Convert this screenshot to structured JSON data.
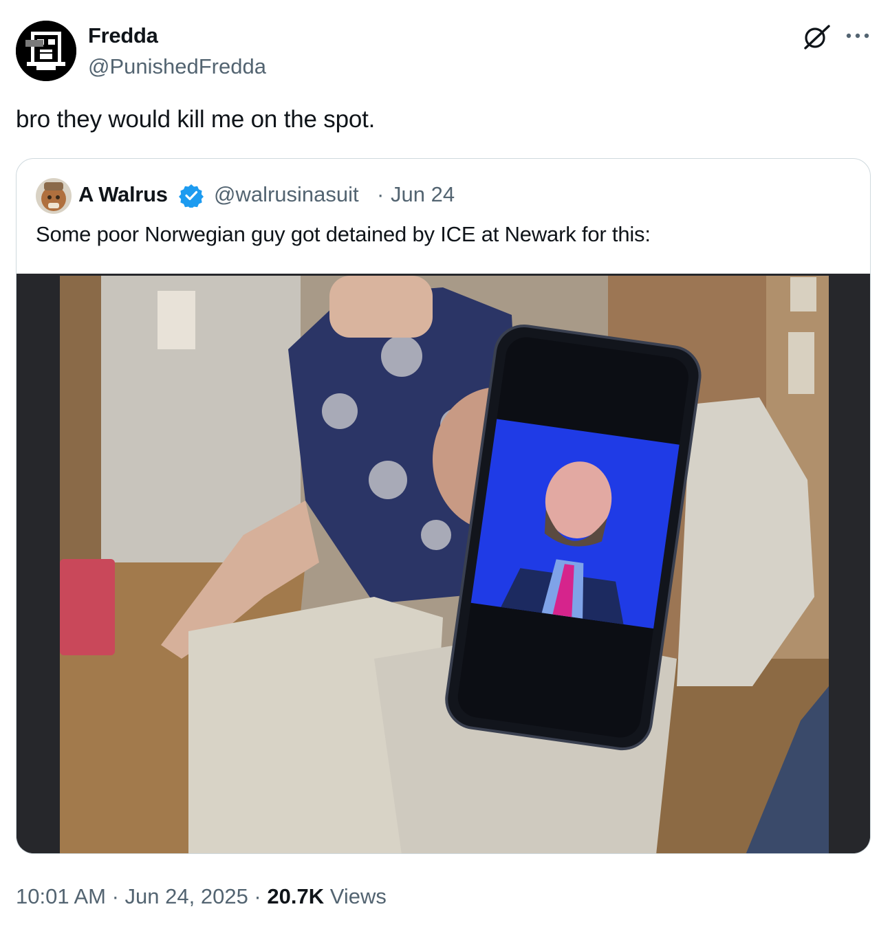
{
  "author": {
    "display_name": "Fredda",
    "handle": "@PunishedFredda",
    "avatar_icon": "pixel-face-avatar"
  },
  "actions": {
    "grok_icon": "grok-slash-icon",
    "more_icon": "more-dots-icon"
  },
  "tweet": {
    "text": "bro they would kill me on the spot."
  },
  "quote": {
    "display_name": "A Walrus",
    "verified": true,
    "handle": "@walrusinasuit",
    "separator": "·",
    "date": "Jun 24",
    "text": "Some poor Norwegian guy got detained by ICE at Newark for this:",
    "media_description_icon": "photo-media"
  },
  "meta": {
    "time": "10:01 AM",
    "sep1": " · ",
    "date": "Jun 24, 2025",
    "sep2": " · ",
    "views_count": "20.7K",
    "views_label": " Views"
  },
  "colors": {
    "text_primary": "#0f1419",
    "text_secondary": "#536471",
    "border": "#cfd9de",
    "verified": "#1d9bf0"
  }
}
